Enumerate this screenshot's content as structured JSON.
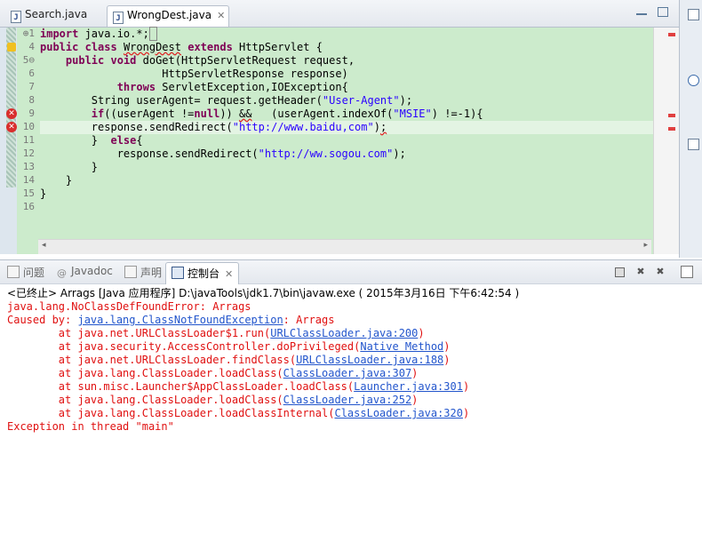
{
  "editor": {
    "tabs": [
      {
        "label": "Search.java",
        "active": false
      },
      {
        "label": "WrongDest.java",
        "active": true
      }
    ],
    "line_numbers": [
      "1",
      "4",
      "5",
      "6",
      "7",
      "8",
      "9",
      "10",
      "11",
      "12",
      "13",
      "14",
      "15",
      "16"
    ],
    "fold_markers": {
      "1": "⊕",
      "5": "⊖"
    }
  },
  "console": {
    "tabs": [
      {
        "label": "问题"
      },
      {
        "label": "Javadoc"
      },
      {
        "label": "声明"
      },
      {
        "label": "控制台",
        "active": true
      }
    ],
    "status": "<已终止> Arrags [Java 应用程序] D:\\javaTools\\jdk1.7\\bin\\javaw.exe ( 2015年3月16日 下午6:42:54 )",
    "lines": [
      {
        "prefix": "java.lang.NoClassDefFoundError: Arrags",
        "link": "",
        "suffix": ""
      },
      {
        "prefix": "Caused by: ",
        "link": "java.lang.ClassNotFoundException",
        "suffix": ": Arrags"
      },
      {
        "prefix": "        at java.net.URLClassLoader$1.run(",
        "link": "URLClassLoader.java:200",
        "suffix": ")"
      },
      {
        "prefix": "        at java.security.AccessController.doPrivileged(",
        "link": "Native Method",
        "suffix": ")"
      },
      {
        "prefix": "        at java.net.URLClassLoader.findClass(",
        "link": "URLClassLoader.java:188",
        "suffix": ")"
      },
      {
        "prefix": "        at java.lang.ClassLoader.loadClass(",
        "link": "ClassLoader.java:307",
        "suffix": ")"
      },
      {
        "prefix": "        at sun.misc.Launcher$AppClassLoader.loadClass(",
        "link": "Launcher.java:301",
        "suffix": ")"
      },
      {
        "prefix": "        at java.lang.ClassLoader.loadClass(",
        "link": "ClassLoader.java:252",
        "suffix": ")"
      },
      {
        "prefix": "        at java.lang.ClassLoader.loadClassInternal(",
        "link": "ClassLoader.java:320",
        "suffix": ")"
      },
      {
        "prefix": "Exception in thread \"main\"",
        "link": "",
        "suffix": ""
      }
    ]
  },
  "colors": {
    "editor_bg": "#ccebcc",
    "keyword": "#7f0055",
    "string": "#2a00ff",
    "error_text": "#e01010",
    "link": "#2255cc"
  }
}
